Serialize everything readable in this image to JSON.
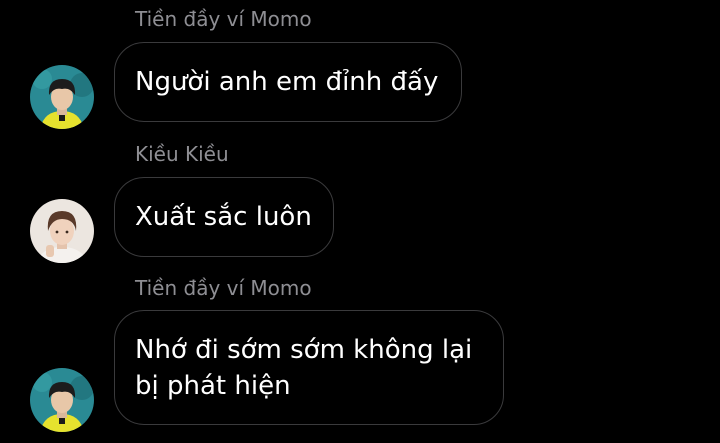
{
  "messages": [
    {
      "sender": "Tiền đầy ví Momo",
      "text": "Người anh em đỉnh đấy",
      "avatar": "avatar-teal-boy-yellow-shirt"
    },
    {
      "sender": "Kiều Kiều",
      "text": "Xuất sắc luôn",
      "avatar": "avatar-boy-light-background"
    },
    {
      "sender": "Tiền đầy ví Momo",
      "text": "Nhớ đi sớm sớm không lại bị phát hiện",
      "avatar": "avatar-teal-boy-yellow-shirt"
    }
  ],
  "colors": {
    "background": "#000000",
    "bubble_border": "#3a3a3c",
    "sender_name": "#8e8e93",
    "message_text": "#ffffff"
  }
}
